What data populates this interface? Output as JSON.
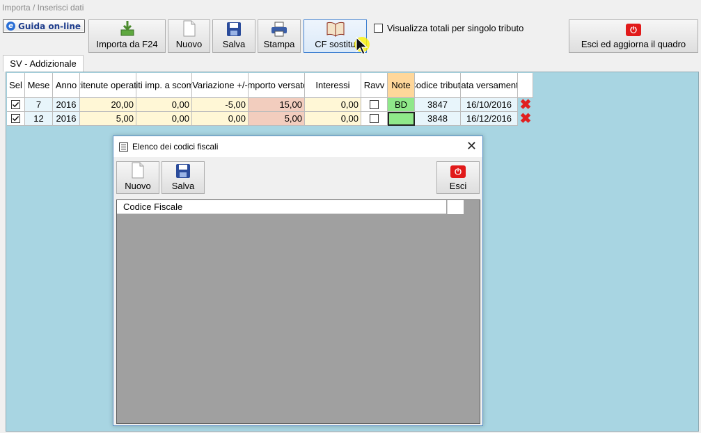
{
  "window": {
    "title": "Importa / Inserisci dati"
  },
  "toolbar": {
    "guida_label": "Guida on-line",
    "importa_label": "Importa da F24",
    "nuovo_label": "Nuovo",
    "salva_label": "Salva",
    "stampa_label": "Stampa",
    "cf_label": "CF sostitu",
    "visualizza_label": "Visualizza totali per singolo tributo",
    "visualizza_checked": false,
    "esci_label": "Esci ed aggiorna il quadro"
  },
  "tab": {
    "label": "SV - Addizionale"
  },
  "grid": {
    "headers": {
      "sel": "Sel",
      "mese": "Mese",
      "anno": "Anno",
      "ritenute": "Ritenute operate",
      "crediti": "Crediti imp. a scomputo",
      "variazione": "Variazione +/-",
      "importo": "Importo versato",
      "interessi": "Interessi",
      "ravv": "Ravv",
      "note": "Note",
      "codice": "Codice tributo",
      "data": "Data versamento"
    },
    "rows": [
      {
        "sel": true,
        "mese": "7",
        "anno": "2016",
        "ritenute": "20,00",
        "crediti": "0,00",
        "variazione": "-5,00",
        "importo": "15,00",
        "interessi": "0,00",
        "ravv": false,
        "note": "BD",
        "codice": "3847",
        "data": "16/10/2016"
      },
      {
        "sel": true,
        "mese": "12",
        "anno": "2016",
        "ritenute": "5,00",
        "crediti": "0,00",
        "variazione": "0,00",
        "importo": "5,00",
        "interessi": "0,00",
        "ravv": false,
        "note": "",
        "codice": "3848",
        "data": "16/12/2016"
      }
    ]
  },
  "dialog": {
    "title": "Elenco dei codici fiscali",
    "nuovo_label": "Nuovo",
    "salva_label": "Salva",
    "esci_label": "Esci",
    "column_header": "Codice Fiscale"
  },
  "colors": {
    "panel_bg": "#a8d5e2",
    "row_cream": "#fff7d6",
    "importo_pink": "#f2cdbe",
    "note_green": "#8fe88a",
    "note_header": "#ffd79a",
    "delete_red": "#e02020"
  },
  "icons": {
    "guida": "ie-e-icon",
    "importa": "download-arrow-icon",
    "nuovo": "blank-page-icon",
    "salva": "floppy-disk-icon",
    "stampa": "printer-icon",
    "cf": "open-book-icon",
    "esci": "power-icon",
    "delete": "red-x-icon"
  }
}
